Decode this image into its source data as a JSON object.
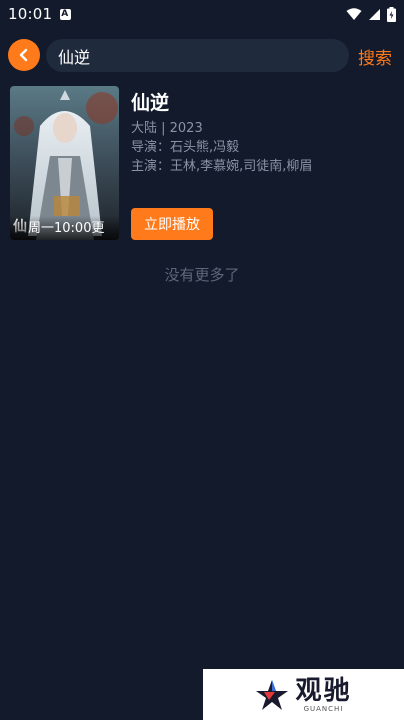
{
  "status_bar": {
    "time": "10:01"
  },
  "search": {
    "query": "仙逆",
    "button_label": "搜索"
  },
  "result": {
    "title": "仙逆",
    "region_year": "大陆 | 2023",
    "director": "导演：石头熊,冯毅",
    "cast": "主演：王林,李慕婉,司徒南,柳眉",
    "poster_caption": "周一10:00更",
    "play_label": "立即播放"
  },
  "footer": {
    "no_more": "没有更多了"
  },
  "watermark": {
    "text": "观驰",
    "subtext": "GUANCHI"
  },
  "colors": {
    "accent": "#ff7a1a",
    "background": "#121a2b",
    "search_bg": "#1f2a3d"
  }
}
